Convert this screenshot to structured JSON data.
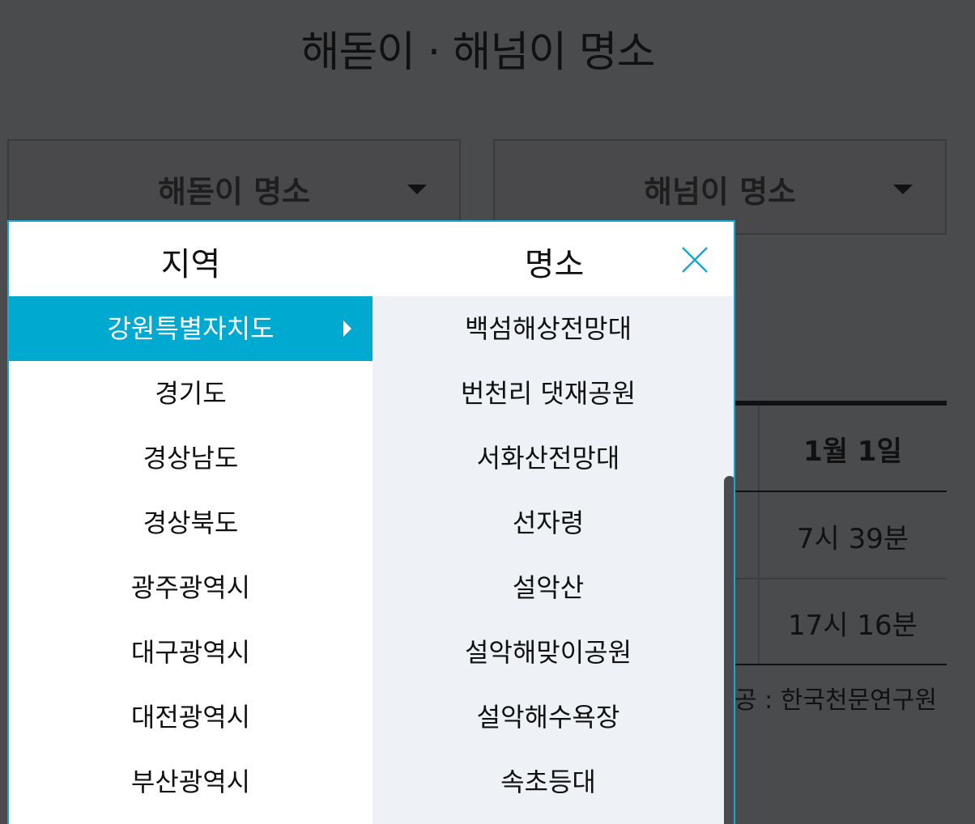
{
  "page": {
    "title": "해돋이 · 해넘이 명소"
  },
  "selectors": {
    "sunrise": {
      "label": "해돋이 명소"
    },
    "sunset": {
      "label": "해넘이 명소"
    }
  },
  "background_table": {
    "header": "1월 1일",
    "row1": "7시 39분",
    "row2": "17시 16분",
    "source": "공 : 한국천문연구원"
  },
  "panel": {
    "region_title": "지역",
    "spot_title": "명소",
    "regions": [
      "강원특별자치도",
      "경기도",
      "경상남도",
      "경상북도",
      "광주광역시",
      "대구광역시",
      "대전광역시",
      "부산광역시"
    ],
    "active_region_index": 0,
    "spots": [
      "백섬해상전망대",
      "번천리 댓재공원",
      "서화산전망대",
      "선자령",
      "설악산",
      "설악해맞이공원",
      "설악해수욕장",
      "속초등대"
    ]
  },
  "colors": {
    "accent": "#00a9cf",
    "overlay": "#4a4b4d",
    "spot_bg": "#eef1f5"
  },
  "icons": {
    "close": "close-icon",
    "caret": "chevron-down-icon",
    "arrow": "chevron-right-icon"
  }
}
